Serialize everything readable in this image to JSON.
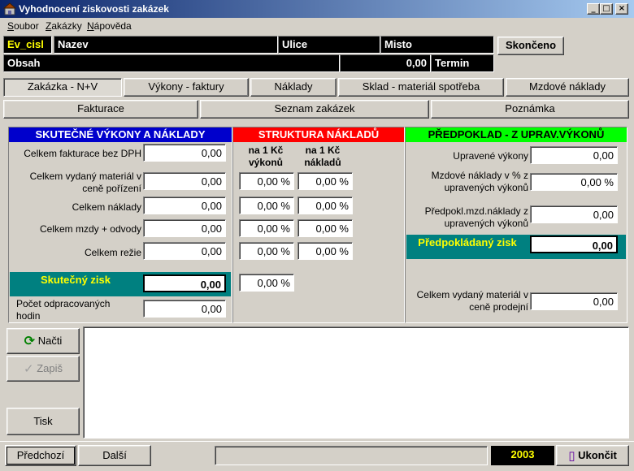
{
  "window": {
    "title": "Vyhodnocení ziskovosti zakázek",
    "min": "_",
    "max": "□",
    "close": "×"
  },
  "menu": [
    "Soubor",
    "Zakázky",
    "Nápověda"
  ],
  "header": {
    "ev_cisl": "Ev_cisl",
    "nazev": "Nazev",
    "ulice": "Ulice",
    "misto": "Misto",
    "obsah": "Obsah",
    "amount": "0,00",
    "termin": "Termin",
    "skonceno": "Skončeno"
  },
  "tabs_row1": [
    "Zakázka - N+V",
    "Výkony - faktury",
    "Náklady",
    "Sklad - materiál spotřeba",
    "Mzdové náklady"
  ],
  "tabs_row2": [
    "Fakturace",
    "Seznam zakázek",
    "Poznámka"
  ],
  "left_panel": {
    "title": "SKUTEČNÉ VÝKONY A NÁKLADY",
    "title_color": "#0000cc",
    "rows": [
      {
        "label": "Celkem fakturace bez DPH",
        "value": "0,00"
      },
      {
        "label": "Celkem  vydaný materiál v ceně pořízení",
        "value": "0,00"
      },
      {
        "label": "Celkem náklady",
        "value": "0,00"
      },
      {
        "label": "Celkem mzdy + odvody",
        "value": "0,00"
      },
      {
        "label": "Celkem režie",
        "value": "0,00"
      }
    ],
    "profit_label": "Skutečný zisk",
    "profit_value": "0,00",
    "hours_label": "Počet odpracovaných hodin",
    "hours_value": "0,00"
  },
  "middle_panel": {
    "title": "STRUKTURA NÁKLADŮ",
    "title_color": "#ff0000",
    "col1": "na 1 Kč výkonů",
    "col2": "na 1 Kč nákladů",
    "rows": [
      {
        "a": "0,00 %",
        "b": "0,00 %"
      },
      {
        "a": "0,00 %",
        "b": "0,00 %"
      },
      {
        "a": "0,00 %",
        "b": "0,00 %"
      },
      {
        "a": "0,00 %",
        "b": "0,00 %"
      }
    ],
    "profit_pct": "0,00 %"
  },
  "right_panel": {
    "title": "PŘEDPOKLAD - Z UPRAV.VÝKONŮ",
    "title_color": "#00ff00",
    "rows": [
      {
        "label": "Upravené výkony",
        "value": "0,00"
      },
      {
        "label": "Mzdové náklady v % z upravených výkonů",
        "value": "0,00 %"
      },
      {
        "label": "Předpokl.mzd.náklady z upravených výkonů",
        "value": "0,00"
      }
    ],
    "profit_label": "Předpokládaný zisk",
    "profit_value": "0,00",
    "material_label": "Celkem  vydaný materiál v ceně prodejní",
    "material_value": "0,00"
  },
  "side_buttons": {
    "nacti": "Načti",
    "zapis": "Zapiš",
    "tisk": "Tisk"
  },
  "footer": {
    "predchozi": "Předchozí",
    "dalsi": "Další",
    "year": "2003",
    "ukoncit": "Ukončit"
  }
}
